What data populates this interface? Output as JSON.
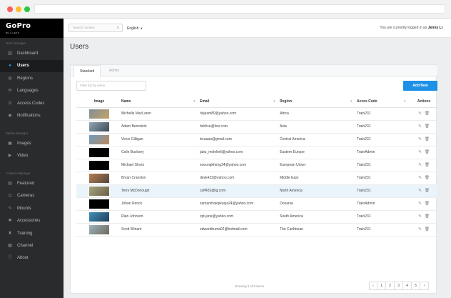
{
  "sidebar": {
    "logo_text": "GoPro",
    "logo_sub": "BE A HERO",
    "sections": [
      {
        "title": "User Manager",
        "items": [
          {
            "label": "Dashboard",
            "icon": "bar-chart-icon",
            "glyph": "▥",
            "active": false
          },
          {
            "label": "Users",
            "icon": "user-icon",
            "glyph": "●",
            "active": true
          },
          {
            "label": "Regions",
            "icon": "globe-icon",
            "glyph": "◍",
            "active": false
          },
          {
            "label": "Languages",
            "icon": "chat-icon",
            "glyph": "✉",
            "active": false
          },
          {
            "label": "Access Codes",
            "icon": "code-icon",
            "glyph": "⌸",
            "active": false
          },
          {
            "label": "Notifications",
            "icon": "bell-icon",
            "glyph": "◉",
            "active": false
          }
        ]
      },
      {
        "title": "Media Manager",
        "items": [
          {
            "label": "Images",
            "icon": "image-icon",
            "glyph": "▣",
            "active": false
          },
          {
            "label": "Video",
            "icon": "video-icon",
            "glyph": "▶",
            "active": false
          }
        ]
      },
      {
        "title": "Content Manager",
        "items": [
          {
            "label": "Featured",
            "icon": "featured-icon",
            "glyph": "▤",
            "active": false
          },
          {
            "label": "Cameras",
            "icon": "camera-icon",
            "glyph": "◘",
            "active": false
          },
          {
            "label": "Mounts",
            "icon": "wrench-icon",
            "glyph": "✎",
            "active": false
          },
          {
            "label": "Accessories",
            "icon": "gear-icon",
            "glyph": "✱",
            "active": false
          },
          {
            "label": "Training",
            "icon": "trophy-icon",
            "glyph": "♜",
            "active": false
          },
          {
            "label": "Channel",
            "icon": "channel-icon",
            "glyph": "▦",
            "active": false
          },
          {
            "label": "About",
            "icon": "info-icon",
            "glyph": "ⓘ",
            "active": false
          }
        ]
      }
    ]
  },
  "topbar": {
    "search_placeholder": "Search content...",
    "language": "English",
    "login_prefix": "You are currently logged in as",
    "user_name": "Jenny Li"
  },
  "page": {
    "title": "Users",
    "tabs": [
      {
        "label": "Standard",
        "active": true
      },
      {
        "label": "Admin",
        "active": false
      }
    ],
    "filter_placeholder": "Filter list by name",
    "add_button": "Add New",
    "columns": [
      "Image",
      "Name",
      "Email",
      "Region",
      "Acces Code",
      "Actions"
    ],
    "rows": [
      {
        "name": "Michelle MacLaren",
        "email": "rlojasm80@yahoo.com",
        "region": "Africa",
        "code": "Train231",
        "thumb": "#7e8f94",
        "thumb2": "#c8a36a",
        "highlight": false
      },
      {
        "name": "Adam Bernstein",
        "email": "hdclive@live.com",
        "region": "Asia",
        "code": "Train231",
        "thumb": "#8ea6b6",
        "thumb2": "#3d4a55",
        "highlight": false
      },
      {
        "name": "Vince Gilligan",
        "email": "terauau@gmail.com",
        "region": "Central America",
        "code": "Train231",
        "thumb": "#6f9bc2",
        "thumb2": "#b98a5a",
        "highlight": false
      },
      {
        "name": "Colin Bucksey",
        "email": "jabu_molekeli@yahoo.com",
        "region": "Eastern Europe",
        "code": "TrainAdmin",
        "thumb": "#000000",
        "thumb2": "#000000",
        "highlight": false
      },
      {
        "name": "Michael Slovis",
        "email": "soeungkheng34@yahoo.com",
        "region": "European Union",
        "code": "Train231",
        "thumb": "#000000",
        "thumb2": "#000000",
        "highlight": false
      },
      {
        "name": "Bryan Cranston",
        "email": "desk433@yahoo.com",
        "region": "Middle East",
        "code": "Train231",
        "thumb": "#b27d52",
        "thumb2": "#55463a",
        "highlight": false
      },
      {
        "name": "Terry McDonough",
        "email": "caff432@lg.com",
        "region": "North America",
        "code": "Train231",
        "thumb": "#a4a37c",
        "thumb2": "#6b5f48",
        "highlight": true
      },
      {
        "name": "Johan Renck",
        "email": "samanthakipkaiya24@yahoo.com",
        "region": "Oceania",
        "code": "TrainAdmin",
        "thumb": "#000000",
        "thumb2": "#000000",
        "highlight": false
      },
      {
        "name": "Rian Johnson",
        "email": "cpt.jane@yahoo.com",
        "region": "South America",
        "code": "Train231",
        "thumb": "#3e8fb8",
        "thumb2": "#1f3f5c",
        "highlight": false
      },
      {
        "name": "Scott Winant",
        "email": "edwardbuma02@hotmail.com",
        "region": "The Caribbean",
        "code": "Train231",
        "thumb": "#9bb2bf",
        "thumb2": "#6e6a5c",
        "highlight": false
      }
    ],
    "showing_text": "showing 5 of 5 items",
    "pages": [
      "1",
      "2",
      "3",
      "4",
      "5"
    ],
    "prev_glyph": "‹",
    "next_glyph": "›",
    "action_glyphs": {
      "edit": "✎",
      "delete": "🗑"
    }
  },
  "colors": {
    "accent": "#1e90e6",
    "sidebar_bg": "#2a2b2d",
    "main_bg": "#eceeef"
  }
}
